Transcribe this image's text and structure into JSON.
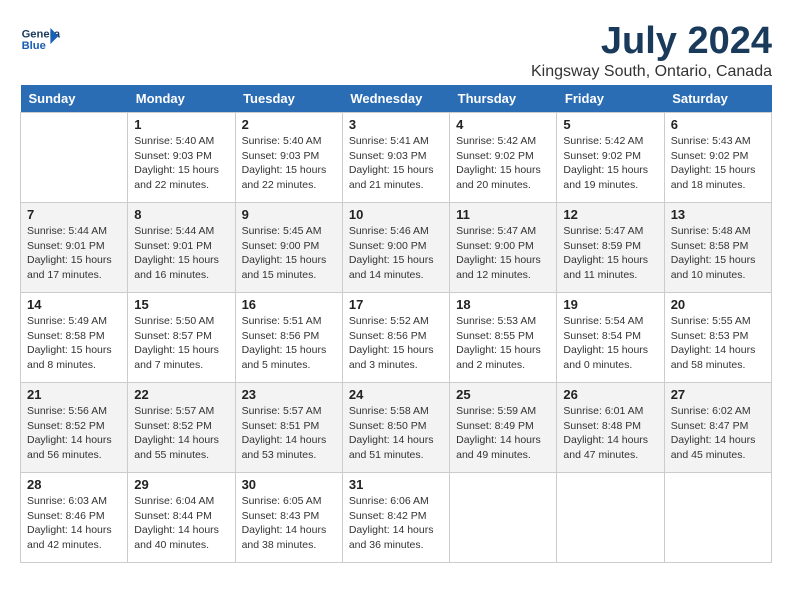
{
  "header": {
    "logo_text_general": "General",
    "logo_text_blue": "Blue",
    "title": "July 2024",
    "subtitle": "Kingsway South, Ontario, Canada"
  },
  "calendar": {
    "weekdays": [
      "Sunday",
      "Monday",
      "Tuesday",
      "Wednesday",
      "Thursday",
      "Friday",
      "Saturday"
    ],
    "weeks": [
      [
        {
          "day": "",
          "info": ""
        },
        {
          "day": "1",
          "info": "Sunrise: 5:40 AM\nSunset: 9:03 PM\nDaylight: 15 hours\nand 22 minutes."
        },
        {
          "day": "2",
          "info": "Sunrise: 5:40 AM\nSunset: 9:03 PM\nDaylight: 15 hours\nand 22 minutes."
        },
        {
          "day": "3",
          "info": "Sunrise: 5:41 AM\nSunset: 9:03 PM\nDaylight: 15 hours\nand 21 minutes."
        },
        {
          "day": "4",
          "info": "Sunrise: 5:42 AM\nSunset: 9:02 PM\nDaylight: 15 hours\nand 20 minutes."
        },
        {
          "day": "5",
          "info": "Sunrise: 5:42 AM\nSunset: 9:02 PM\nDaylight: 15 hours\nand 19 minutes."
        },
        {
          "day": "6",
          "info": "Sunrise: 5:43 AM\nSunset: 9:02 PM\nDaylight: 15 hours\nand 18 minutes."
        }
      ],
      [
        {
          "day": "7",
          "info": "Sunrise: 5:44 AM\nSunset: 9:01 PM\nDaylight: 15 hours\nand 17 minutes."
        },
        {
          "day": "8",
          "info": "Sunrise: 5:44 AM\nSunset: 9:01 PM\nDaylight: 15 hours\nand 16 minutes."
        },
        {
          "day": "9",
          "info": "Sunrise: 5:45 AM\nSunset: 9:00 PM\nDaylight: 15 hours\nand 15 minutes."
        },
        {
          "day": "10",
          "info": "Sunrise: 5:46 AM\nSunset: 9:00 PM\nDaylight: 15 hours\nand 14 minutes."
        },
        {
          "day": "11",
          "info": "Sunrise: 5:47 AM\nSunset: 9:00 PM\nDaylight: 15 hours\nand 12 minutes."
        },
        {
          "day": "12",
          "info": "Sunrise: 5:47 AM\nSunset: 8:59 PM\nDaylight: 15 hours\nand 11 minutes."
        },
        {
          "day": "13",
          "info": "Sunrise: 5:48 AM\nSunset: 8:58 PM\nDaylight: 15 hours\nand 10 minutes."
        }
      ],
      [
        {
          "day": "14",
          "info": "Sunrise: 5:49 AM\nSunset: 8:58 PM\nDaylight: 15 hours\nand 8 minutes."
        },
        {
          "day": "15",
          "info": "Sunrise: 5:50 AM\nSunset: 8:57 PM\nDaylight: 15 hours\nand 7 minutes."
        },
        {
          "day": "16",
          "info": "Sunrise: 5:51 AM\nSunset: 8:56 PM\nDaylight: 15 hours\nand 5 minutes."
        },
        {
          "day": "17",
          "info": "Sunrise: 5:52 AM\nSunset: 8:56 PM\nDaylight: 15 hours\nand 3 minutes."
        },
        {
          "day": "18",
          "info": "Sunrise: 5:53 AM\nSunset: 8:55 PM\nDaylight: 15 hours\nand 2 minutes."
        },
        {
          "day": "19",
          "info": "Sunrise: 5:54 AM\nSunset: 8:54 PM\nDaylight: 15 hours\nand 0 minutes."
        },
        {
          "day": "20",
          "info": "Sunrise: 5:55 AM\nSunset: 8:53 PM\nDaylight: 14 hours\nand 58 minutes."
        }
      ],
      [
        {
          "day": "21",
          "info": "Sunrise: 5:56 AM\nSunset: 8:52 PM\nDaylight: 14 hours\nand 56 minutes."
        },
        {
          "day": "22",
          "info": "Sunrise: 5:57 AM\nSunset: 8:52 PM\nDaylight: 14 hours\nand 55 minutes."
        },
        {
          "day": "23",
          "info": "Sunrise: 5:57 AM\nSunset: 8:51 PM\nDaylight: 14 hours\nand 53 minutes."
        },
        {
          "day": "24",
          "info": "Sunrise: 5:58 AM\nSunset: 8:50 PM\nDaylight: 14 hours\nand 51 minutes."
        },
        {
          "day": "25",
          "info": "Sunrise: 5:59 AM\nSunset: 8:49 PM\nDaylight: 14 hours\nand 49 minutes."
        },
        {
          "day": "26",
          "info": "Sunrise: 6:01 AM\nSunset: 8:48 PM\nDaylight: 14 hours\nand 47 minutes."
        },
        {
          "day": "27",
          "info": "Sunrise: 6:02 AM\nSunset: 8:47 PM\nDaylight: 14 hours\nand 45 minutes."
        }
      ],
      [
        {
          "day": "28",
          "info": "Sunrise: 6:03 AM\nSunset: 8:46 PM\nDaylight: 14 hours\nand 42 minutes."
        },
        {
          "day": "29",
          "info": "Sunrise: 6:04 AM\nSunset: 8:44 PM\nDaylight: 14 hours\nand 40 minutes."
        },
        {
          "day": "30",
          "info": "Sunrise: 6:05 AM\nSunset: 8:43 PM\nDaylight: 14 hours\nand 38 minutes."
        },
        {
          "day": "31",
          "info": "Sunrise: 6:06 AM\nSunset: 8:42 PM\nDaylight: 14 hours\nand 36 minutes."
        },
        {
          "day": "",
          "info": ""
        },
        {
          "day": "",
          "info": ""
        },
        {
          "day": "",
          "info": ""
        }
      ]
    ]
  }
}
